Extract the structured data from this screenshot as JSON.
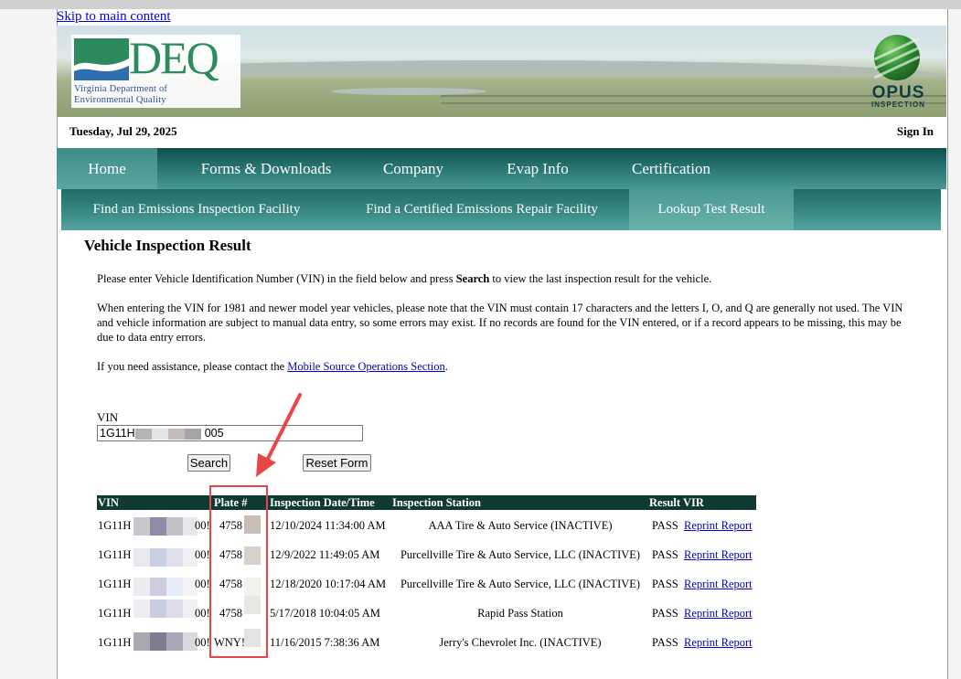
{
  "skip_link": "Skip to main content",
  "logo": {
    "word": "DEQ",
    "line1": "Virginia Department of",
    "line2": "Environmental Quality"
  },
  "opus": {
    "word": "OPUS",
    "sub": "INSPECTION"
  },
  "date": "Tuesday, Jul 29, 2025",
  "sign_in": "Sign In",
  "nav": [
    "Home",
    "Forms & Downloads",
    "Company",
    "Evap Info",
    "Certification"
  ],
  "subnav": [
    "Find an Emissions Inspection Facility",
    "Find a Certified Emissions Repair Facility",
    "Lookup Test Result"
  ],
  "page_title": "Vehicle Inspection Result",
  "p1": {
    "before": "Please enter Vehicle Identification Number (VIN) in the field below and press ",
    "bold": "Search",
    "after": " to view the last inspection result for the vehicle."
  },
  "p2": "When entering the VIN for 1981 and newer model year vehicles, please note that the VIN must contain 17 characters and the letters I, O, and Q are generally not used. The VIN and vehicle information are subject to manual data entry, so some errors may exist. If no records are found for the VIN entered, or if a record appears to be missing, this may be due to data entry errors.",
  "p3": {
    "before": "If you need assistance, please contact the ",
    "link": "Mobile Source Operations Section",
    "after": "."
  },
  "vin": {
    "label": "VIN",
    "prefix": "1G11H",
    "suffix": "005"
  },
  "buttons": {
    "search": "Search",
    "reset": "Reset Form"
  },
  "table": {
    "headers": [
      "VIN",
      "Plate #",
      "Inspection Date/Time",
      "Inspection Station",
      "Result",
      "VIR"
    ],
    "rows": [
      {
        "vin": "1G11H",
        "vin_end": "00!",
        "plate": "4758",
        "date": "12/10/2024 11:34:00 AM",
        "station": "AAA Tire & Auto Service (INACTIVE)",
        "result": "PASS",
        "vir": "Reprint Report"
      },
      {
        "vin": "1G11H",
        "vin_end": "00!",
        "plate": "4758",
        "date": "12/9/2022 11:49:05 AM",
        "station": "Purcellville Tire & Auto Service, LLC (INACTIVE)",
        "result": "PASS",
        "vir": "Reprint Report"
      },
      {
        "vin": "1G11H",
        "vin_end": "00!",
        "plate": "4758",
        "date": "12/18/2020 10:17:04 AM",
        "station": "Purcellville Tire & Auto Service, LLC (INACTIVE)",
        "result": "PASS",
        "vir": "Reprint Report"
      },
      {
        "vin": "1G11H",
        "vin_end": "00!",
        "plate": "4758",
        "date": "5/17/2018 10:04:05 AM",
        "station": "Rapid Pass Station",
        "result": "PASS",
        "vir": "Reprint Report"
      },
      {
        "vin": "1G11H",
        "vin_end": "00!",
        "plate": "WNY!",
        "date": "11/16/2015 7:38:36 AM",
        "station": "Jerry's Chevrolet Inc. (INACTIVE)",
        "result": "PASS",
        "vir": "Reprint Report"
      }
    ]
  },
  "colors": {
    "nav_dark": "#0f4f4e",
    "nav_light": "#4a9a93",
    "table_header": "#0f3a33",
    "link": "#0000cc",
    "callout": "#e84646"
  }
}
